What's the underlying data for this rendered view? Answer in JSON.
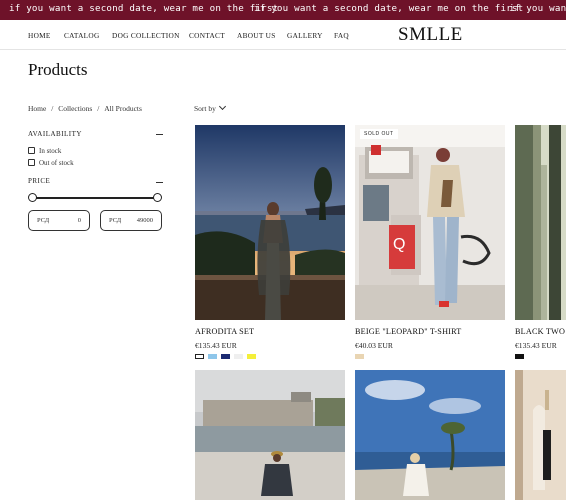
{
  "announcement": {
    "messages": [
      "if you want a second date, wear me on the first",
      "if you want a second date, wear me on the first",
      "if you want a second date, wear me on the first"
    ]
  },
  "header": {
    "logo": "SMLLE",
    "nav": [
      "HOME",
      "CATALOG",
      "DOG COLLECTION",
      "CONTACT",
      "ABOUT US",
      "GALLERY",
      "FAQ"
    ]
  },
  "page": {
    "title": "Products"
  },
  "breadcrumb": [
    "Home",
    "/",
    "Collections",
    "/",
    "All Products"
  ],
  "sort": {
    "label": "Sort by"
  },
  "filters": {
    "availability": {
      "title": "AVAILABILITY",
      "options": [
        "In stock",
        "Out of stock"
      ]
    },
    "price": {
      "title": "PRICE",
      "currency": "РСД",
      "min_value": "0",
      "max_value": "49000",
      "range_fraction": [
        0,
        1
      ]
    }
  },
  "products": [
    {
      "name": "AFRODITA SET",
      "price": "€135.43 EUR",
      "swatches": [
        "#ffffff",
        "#8ec6ea",
        "#1b2a72",
        "#efefef",
        "#f4ef3a"
      ],
      "badge": ""
    },
    {
      "name": "BEIGE \"LEOPARD\" T-SHIRT",
      "price": "€40.03 EUR",
      "swatches": [
        "#e9d5b3"
      ],
      "badge": "SOLD OUT"
    },
    {
      "name": "BLACK TWO",
      "price": "€135.43 EUR",
      "swatches": [
        "#111111"
      ],
      "badge": ""
    }
  ],
  "colors": {
    "announcement_bg": "#6e1229",
    "text": "#1a1a1a"
  }
}
